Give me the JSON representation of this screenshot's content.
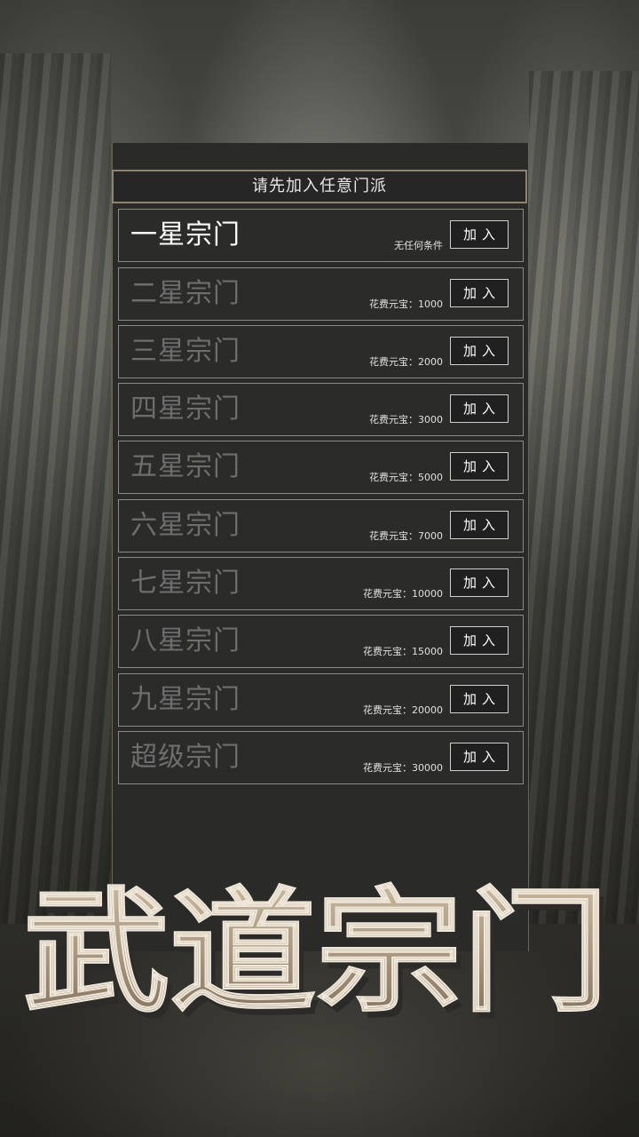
{
  "header": {
    "title": "请先加入任意门派"
  },
  "sects": [
    {
      "name": "一星宗门",
      "cost": "无任何条件",
      "join_label": "加入",
      "active": true
    },
    {
      "name": "二星宗门",
      "cost": "花费元宝：1000",
      "join_label": "加入",
      "active": false
    },
    {
      "name": "三星宗门",
      "cost": "花费元宝：2000",
      "join_label": "加入",
      "active": false
    },
    {
      "name": "四星宗门",
      "cost": "花费元宝：3000",
      "join_label": "加入",
      "active": false
    },
    {
      "name": "五星宗门",
      "cost": "花费元宝：5000",
      "join_label": "加入",
      "active": false
    },
    {
      "name": "六星宗门",
      "cost": "花费元宝：7000",
      "join_label": "加入",
      "active": false
    },
    {
      "name": "七星宗门",
      "cost": "花费元宝：10000",
      "join_label": "加入",
      "active": false
    },
    {
      "name": "八星宗门",
      "cost": "花费元宝：15000",
      "join_label": "加入",
      "active": false
    },
    {
      "name": "九星宗门",
      "cost": "花费元宝：20000",
      "join_label": "加入",
      "active": false
    },
    {
      "name": "超级宗门",
      "cost": "花费元宝：30000",
      "join_label": "加入",
      "active": false
    }
  ],
  "logo": {
    "text": "武道宗门"
  },
  "colors": {
    "panel_bg": "#2a2a29",
    "panel_border": "#8f8370",
    "active_text": "#ffffff",
    "inactive_text": "#6e6e6e",
    "logo_wood": "#a99780"
  }
}
